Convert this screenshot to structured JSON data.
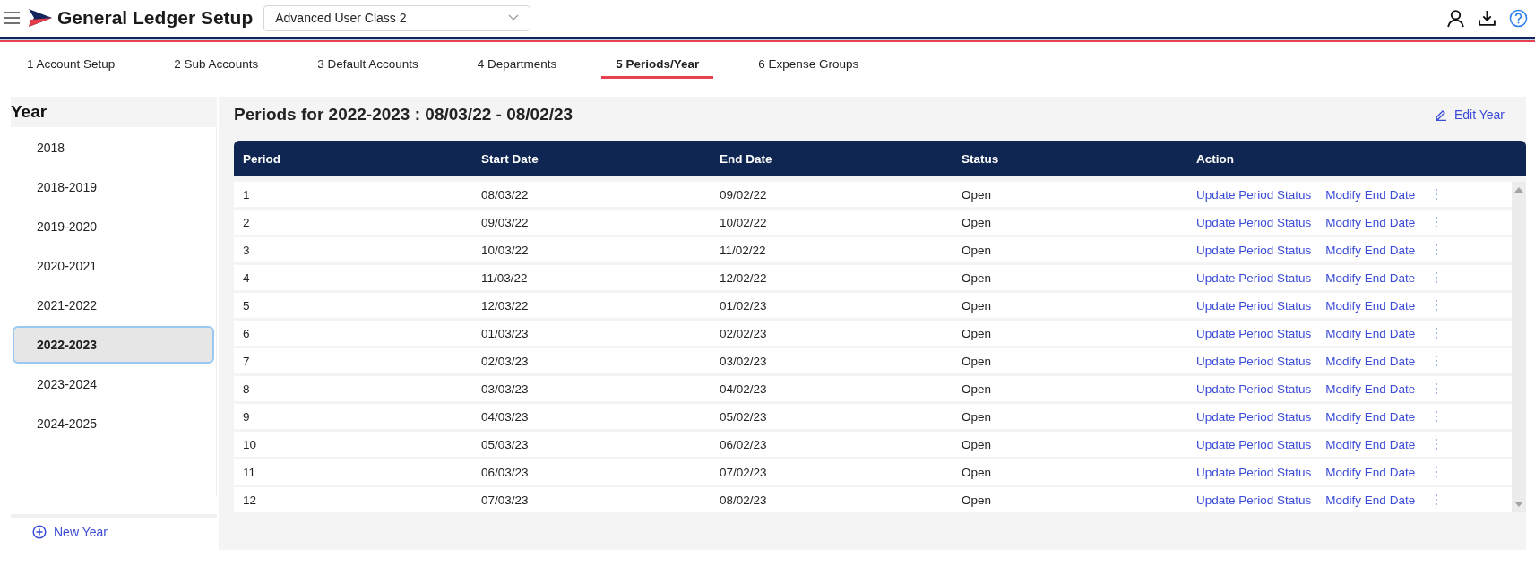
{
  "header": {
    "title": "General Ledger Setup",
    "user_class": "Advanced User Class 2"
  },
  "tabs": [
    {
      "label": "1 Account Setup",
      "selected": false
    },
    {
      "label": "2 Sub Accounts",
      "selected": false
    },
    {
      "label": "3 Default Accounts",
      "selected": false
    },
    {
      "label": "4 Departments",
      "selected": false
    },
    {
      "label": "5 Periods/Year",
      "selected": true
    },
    {
      "label": "6 Expense Groups",
      "selected": false
    }
  ],
  "year_panel": {
    "heading": "Year",
    "items": [
      {
        "label": "2018",
        "selected": false
      },
      {
        "label": "2018-2019",
        "selected": false
      },
      {
        "label": "2019-2020",
        "selected": false
      },
      {
        "label": "2020-2021",
        "selected": false
      },
      {
        "label": "2021-2022",
        "selected": false
      },
      {
        "label": "2022-2023",
        "selected": true
      },
      {
        "label": "2023-2024",
        "selected": false
      },
      {
        "label": "2024-2025",
        "selected": false
      }
    ],
    "new_button": "New Year"
  },
  "periods": {
    "title": "Periods for 2022-2023 : 08/03/22 - 08/02/23",
    "edit_button": "Edit Year",
    "columns": [
      "Period",
      "Start Date",
      "End Date",
      "Status",
      "Action"
    ],
    "rows": [
      {
        "period": "1",
        "start": "08/03/22",
        "end": "09/02/22",
        "status": "Open",
        "actions": [
          "Update Period Status",
          "Modify End Date"
        ]
      },
      {
        "period": "2",
        "start": "09/03/22",
        "end": "10/02/22",
        "status": "Open",
        "actions": [
          "Update Period Status",
          "Modify End Date"
        ]
      },
      {
        "period": "3",
        "start": "10/03/22",
        "end": "11/02/22",
        "status": "Open",
        "actions": [
          "Update Period Status",
          "Modify End Date"
        ]
      },
      {
        "period": "4",
        "start": "11/03/22",
        "end": "12/02/22",
        "status": "Open",
        "actions": [
          "Update Period Status",
          "Modify End Date"
        ]
      },
      {
        "period": "5",
        "start": "12/03/22",
        "end": "01/02/23",
        "status": "Open",
        "actions": [
          "Update Period Status",
          "Modify End Date"
        ]
      },
      {
        "period": "6",
        "start": "01/03/23",
        "end": "02/02/23",
        "status": "Open",
        "actions": [
          "Update Period Status",
          "Modify End Date"
        ]
      },
      {
        "period": "7",
        "start": "02/03/23",
        "end": "03/02/23",
        "status": "Open",
        "actions": [
          "Update Period Status",
          "Modify End Date"
        ]
      },
      {
        "period": "8",
        "start": "03/03/23",
        "end": "04/02/23",
        "status": "Open",
        "actions": [
          "Update Period Status",
          "Modify End Date"
        ]
      },
      {
        "period": "9",
        "start": "04/03/23",
        "end": "05/02/23",
        "status": "Open",
        "actions": [
          "Update Period Status",
          "Modify End Date"
        ]
      },
      {
        "period": "10",
        "start": "05/03/23",
        "end": "06/02/23",
        "status": "Open",
        "actions": [
          "Update Period Status",
          "Modify End Date"
        ]
      },
      {
        "period": "11",
        "start": "06/03/23",
        "end": "07/02/23",
        "status": "Open",
        "actions": [
          "Update Period Status",
          "Modify End Date"
        ]
      },
      {
        "period": "12",
        "start": "07/03/23",
        "end": "08/02/23",
        "status": "Open",
        "actions": [
          "Update Period Status",
          "Modify End Date"
        ]
      }
    ]
  }
}
